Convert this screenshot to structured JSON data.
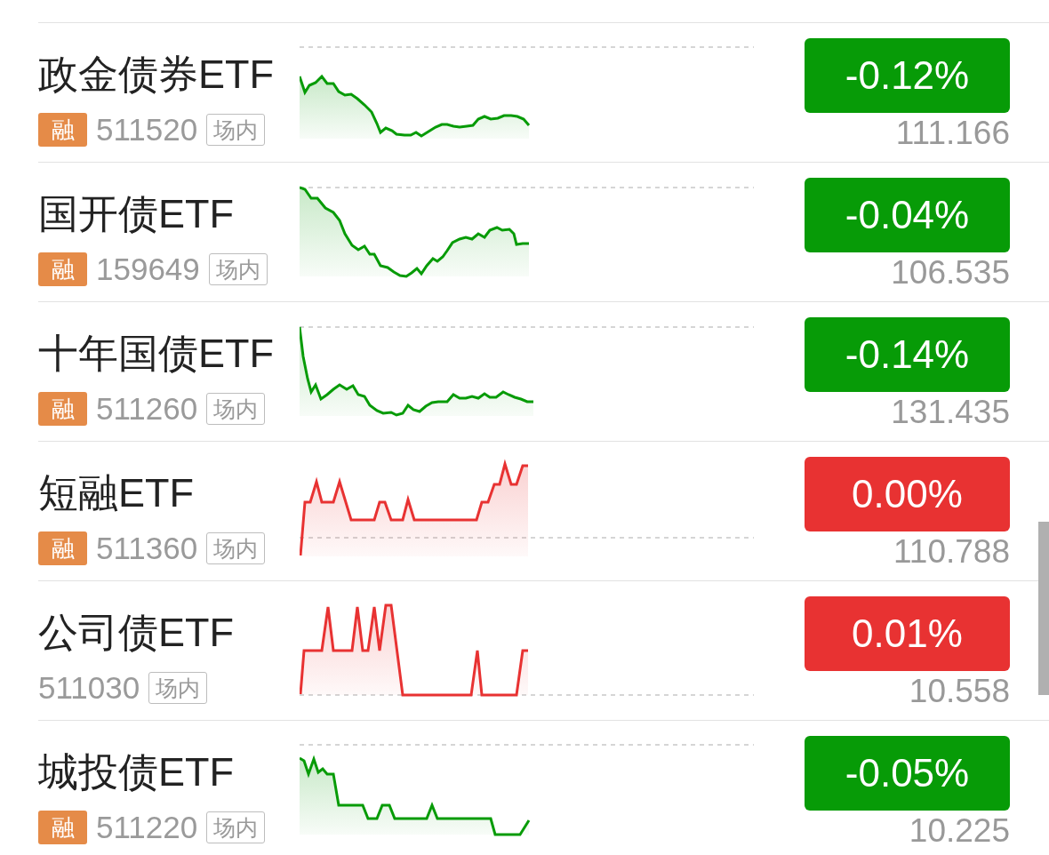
{
  "rows": [
    {
      "name": "政金债券ETF",
      "margin_badge": "融",
      "code": "511520",
      "venue": "场内",
      "change": "-0.12%",
      "price": "111.166",
      "color": "#079b07"
    },
    {
      "name": "国开债ETF",
      "margin_badge": "融",
      "code": "159649",
      "venue": "场内",
      "change": "-0.04%",
      "price": "106.535",
      "color": "#079b07"
    },
    {
      "name": "十年国债ETF",
      "margin_badge": "融",
      "code": "511260",
      "venue": "场内",
      "change": "-0.14%",
      "price": "131.435",
      "color": "#079b07"
    },
    {
      "name": "短融ETF",
      "margin_badge": "融",
      "code": "511360",
      "venue": "场内",
      "change": "0.00%",
      "price": "110.788",
      "color": "#e83232"
    },
    {
      "name": "公司债ETF",
      "code": "511030",
      "venue": "场内",
      "change": "0.01%",
      "price": "10.558",
      "color": "#e83232"
    },
    {
      "name": "城投债ETF",
      "margin_badge": "融",
      "code": "511220",
      "venue": "场内",
      "change": "-0.05%",
      "price": "10.225",
      "color": "#079b07"
    }
  ]
}
